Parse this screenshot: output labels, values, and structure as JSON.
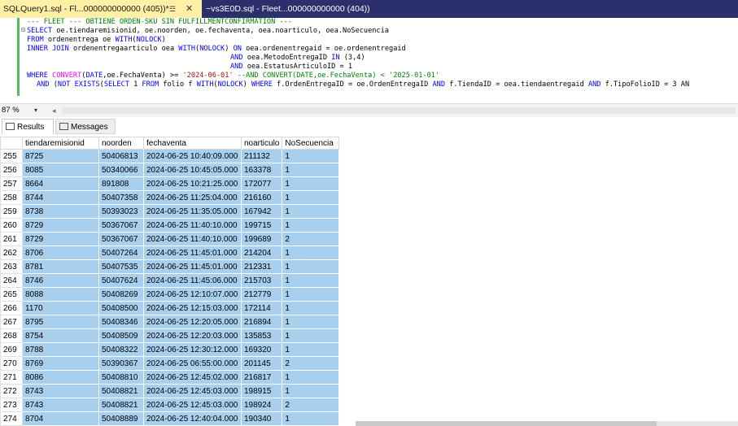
{
  "tabs": [
    {
      "label": "SQLQuery1.sql - Fl...000000000000 (405))*",
      "pin": "☲",
      "close": "✕"
    },
    {
      "label": "~vs3E0D.sql - Fleet...000000000000 (404))"
    }
  ],
  "editor": {
    "lines": [
      "--- FLEET --- OBTIENE ORDEN-SKU SIN FULFILLMENTCONFIRMATION ---",
      "SELECT oe.tiendaremisionid, oe.noorden, oe.fechaventa, oea.noarticulo, oea.NoSecuencia",
      "FROM ordenentrega oe WITH(NOLOCK)",
      "INNER JOIN ordenentregaarticulo oea WITH(NOLOCK) ON oea.ordenentregaid = oe.ordenentregaid",
      "AND oea.MetodoEntregaID IN (3,4)",
      "AND oea.EstatusArticuloID = 1",
      "WHERE CONVERT(DATE,oe.FechaVenta) >= '2024-06-01' --AND CONVERT(DATE,oe.FechaVenta) < '2025-01-01'",
      "AND (NOT EXISTS(SELECT 1 FROM folio f WITH(NOLOCK) WHERE f.OrdenEntregaID = oe.OrdenEntregaID AND f.TiendaID = oea.tiendaentregaid AND f.TipoFolioID = 3 AN"
    ]
  },
  "zoom": "87 %",
  "results_tabs": [
    "Results",
    "Messages"
  ],
  "grid": {
    "columns": [
      "tiendaremisionid",
      "noorden",
      "fechaventa",
      "noarticulo",
      "NoSecuencia"
    ],
    "rows": [
      [
        "255",
        "8725",
        "50406813",
        "2024-06-25 10:40:09.000",
        "211132",
        "1"
      ],
      [
        "256",
        "8085",
        "50340066",
        "2024-06-25 10:45:05.000",
        "163378",
        "1"
      ],
      [
        "257",
        "8664",
        "891808",
        "2024-06-25 10:21:25.000",
        "172077",
        "1"
      ],
      [
        "258",
        "8744",
        "50407358",
        "2024-06-25 11:25:04.000",
        "216160",
        "1"
      ],
      [
        "259",
        "8738",
        "50393023",
        "2024-06-25 11:35:05.000",
        "167942",
        "1"
      ],
      [
        "260",
        "8729",
        "50367067",
        "2024-06-25 11:40:10.000",
        "199715",
        "1"
      ],
      [
        "261",
        "8729",
        "50367067",
        "2024-06-25 11:40:10.000",
        "199689",
        "2"
      ],
      [
        "262",
        "8706",
        "50407264",
        "2024-06-25 11:45:01.000",
        "214204",
        "1"
      ],
      [
        "263",
        "8781",
        "50407535",
        "2024-06-25 11:45:01.000",
        "212331",
        "1"
      ],
      [
        "264",
        "8746",
        "50407624",
        "2024-06-25 11:45:06.000",
        "215703",
        "1"
      ],
      [
        "265",
        "8088",
        "50408269",
        "2024-06-25 12:10:07.000",
        "212779",
        "1"
      ],
      [
        "266",
        "1170",
        "50408500",
        "2024-06-25 12:15:03.000",
        "172114",
        "1"
      ],
      [
        "267",
        "8795",
        "50408346",
        "2024-06-25 12:20:05.000",
        "216894",
        "1"
      ],
      [
        "268",
        "8754",
        "50408509",
        "2024-06-25 12:20:03.000",
        "135853",
        "1"
      ],
      [
        "269",
        "8788",
        "50408322",
        "2024-06-25 12:30:12.000",
        "169320",
        "1"
      ],
      [
        "270",
        "8769",
        "50390367",
        "2024-06-25 06:55:00.000",
        "201145",
        "2"
      ],
      [
        "271",
        "8086",
        "50408810",
        "2024-06-25 12:45:02.000",
        "216817",
        "1"
      ],
      [
        "272",
        "8743",
        "50408821",
        "2024-06-25 12:45:03.000",
        "198915",
        "1"
      ],
      [
        "273",
        "8743",
        "50408821",
        "2024-06-25 12:45:03.000",
        "198924",
        "2"
      ],
      [
        "274",
        "8704",
        "50408889",
        "2024-06-25 12:40:04.000",
        "190340",
        "1"
      ]
    ]
  },
  "colors": {
    "tabbar": "#2b2f6b",
    "active_tab": "#fff0a6",
    "cell_selected": "#a8cfee",
    "keyword": "#0000ff",
    "comment": "#008000",
    "string": "#a31515"
  }
}
